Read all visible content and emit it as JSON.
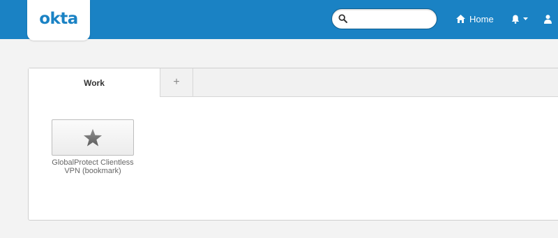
{
  "header": {
    "logo_text": "okta",
    "brand_color": "#1a82c4",
    "search": {
      "placeholder": "",
      "value": "",
      "icon": "search-icon"
    },
    "nav": {
      "home_label": "Home",
      "home_icon": "home-icon",
      "notifications_icon": "bell-icon",
      "user_icon": "user-icon"
    }
  },
  "dashboard": {
    "tabs": [
      {
        "label": "Work",
        "active": true
      },
      {
        "label": "+",
        "active": false
      }
    ],
    "apps": [
      {
        "label": "GlobalProtect Clientless VPN (bookmark)",
        "icon": "star-icon"
      }
    ]
  }
}
